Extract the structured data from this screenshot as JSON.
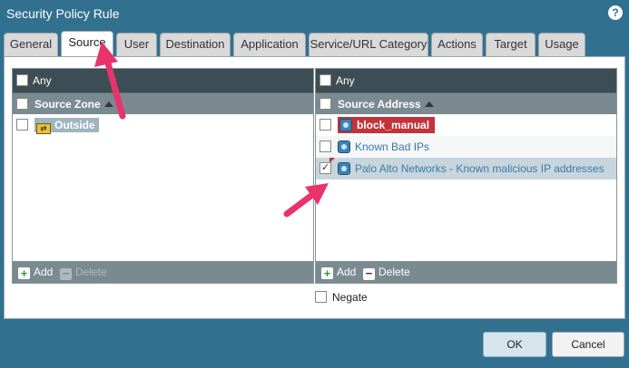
{
  "window": {
    "title": "Security Policy Rule"
  },
  "tabs": [
    {
      "label": "General"
    },
    {
      "label": "Source"
    },
    {
      "label": "User"
    },
    {
      "label": "Destination"
    },
    {
      "label": "Application"
    },
    {
      "label": "Service/URL Category"
    },
    {
      "label": "Actions"
    },
    {
      "label": "Target"
    },
    {
      "label": "Usage"
    }
  ],
  "active_tab": "Source",
  "source_zone": {
    "any_label": "Any",
    "header": "Source Zone",
    "items": [
      {
        "label": "Outside",
        "checked": false
      }
    ],
    "add_label": "Add",
    "delete_label": "Delete"
  },
  "source_address": {
    "any_label": "Any",
    "header": "Source Address",
    "items": [
      {
        "label": "block_manual",
        "checked": false
      },
      {
        "label": "Known Bad IPs",
        "checked": false
      },
      {
        "label": "Palo Alto Networks - Known malicious IP addresses",
        "checked": true
      }
    ],
    "add_label": "Add",
    "delete_label": "Delete"
  },
  "negate_label": "Negate",
  "buttons": {
    "ok": "OK",
    "cancel": "Cancel"
  },
  "colors": {
    "titlebar": "#32708f",
    "header": "#7b8a91",
    "tag_red": "#c3333a",
    "arrow": "#e8336d"
  }
}
